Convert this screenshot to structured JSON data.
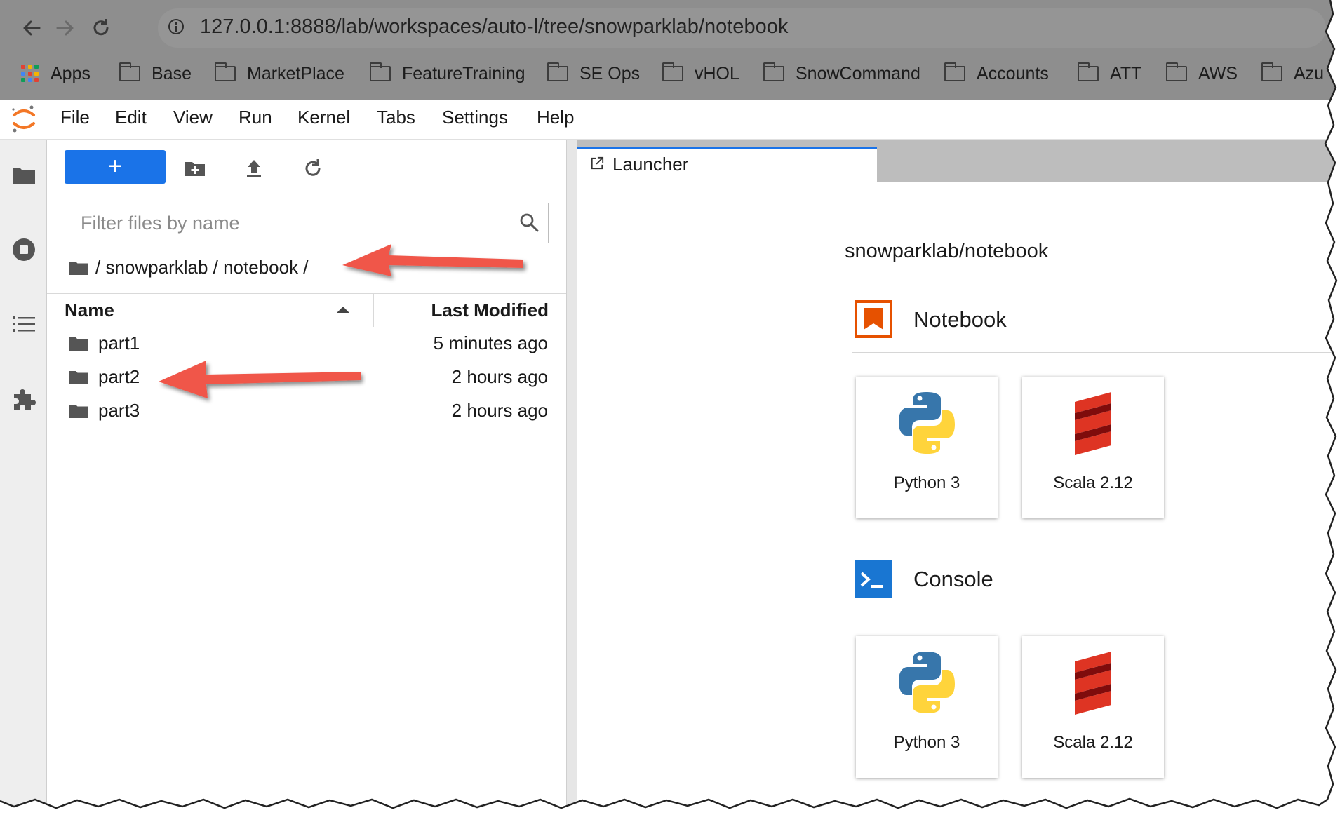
{
  "browser": {
    "url": "127.0.0.1:8888/lab/workspaces/auto-l/tree/snowparklab/notebook",
    "nav_icons": [
      "back-arrow-icon",
      "forward-arrow-icon",
      "reload-icon",
      "info-icon"
    ],
    "bookmarks": [
      {
        "label": "Apps",
        "icon": "apps-grid-icon"
      },
      {
        "label": "Base",
        "icon": "folder-icon"
      },
      {
        "label": "MarketPlace",
        "icon": "folder-icon"
      },
      {
        "label": "FeatureTraining",
        "icon": "folder-icon"
      },
      {
        "label": "SE Ops",
        "icon": "folder-icon"
      },
      {
        "label": "vHOL",
        "icon": "folder-icon"
      },
      {
        "label": "SnowCommand",
        "icon": "folder-icon"
      },
      {
        "label": "Accounts",
        "icon": "folder-icon"
      },
      {
        "label": "ATT",
        "icon": "folder-icon"
      },
      {
        "label": "AWS",
        "icon": "folder-icon"
      },
      {
        "label": "Azu",
        "icon": "folder-icon"
      }
    ]
  },
  "menu": [
    "File",
    "Edit",
    "View",
    "Run",
    "Kernel",
    "Tabs",
    "Settings",
    "Help"
  ],
  "sidebar_icons": [
    "folder-icon",
    "running-stop-icon",
    "toc-list-icon",
    "extensions-puzzle-icon"
  ],
  "file_browser": {
    "new_button_label": "+",
    "toolbar_icons": [
      "new-folder-icon",
      "upload-icon",
      "refresh-icon"
    ],
    "filter_placeholder": "Filter files by name",
    "breadcrumb": "/ snowparklab / notebook /",
    "columns": {
      "name": "Name",
      "modified": "Last Modified"
    },
    "rows": [
      {
        "name": "part1",
        "modified": "5 minutes ago"
      },
      {
        "name": "part2",
        "modified": "2 hours ago"
      },
      {
        "name": "part3",
        "modified": "2 hours ago"
      }
    ]
  },
  "launcher": {
    "tab_label": "Launcher",
    "cwd": "snowparklab/notebook",
    "sections": [
      {
        "title": "Notebook",
        "icon": "notebook-bookmark-icon",
        "kernels": [
          "Python 3",
          "Scala 2.12"
        ]
      },
      {
        "title": "Console",
        "icon": "console-prompt-icon",
        "kernels": [
          "Python 3",
          "Scala 2.12"
        ]
      }
    ]
  },
  "colors": {
    "accent": "#1a73e8",
    "annotation_arrow": "#f0574a",
    "jupyter_orange": "#f37726"
  }
}
